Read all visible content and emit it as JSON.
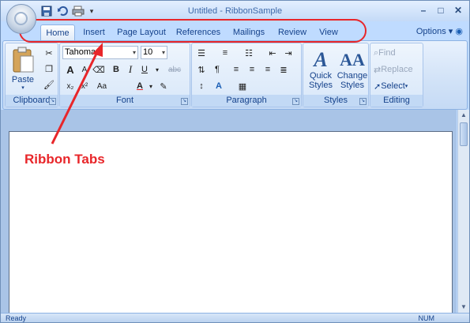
{
  "window": {
    "title": "Untitled - RibbonSample"
  },
  "quick_access": {
    "items": [
      "save-icon",
      "undo-icon",
      "print-icon"
    ]
  },
  "tabs": [
    {
      "label": "Home",
      "active": true
    },
    {
      "label": "Insert"
    },
    {
      "label": "Page Layout"
    },
    {
      "label": "References"
    },
    {
      "label": "Mailings"
    },
    {
      "label": "Review"
    },
    {
      "label": "View"
    }
  ],
  "options_label": "Options",
  "clipboard": {
    "label": "Clipboard",
    "paste_label": "Paste"
  },
  "font": {
    "label": "Font",
    "family": "Tahoma",
    "size": "10",
    "bold": "B",
    "italic": "I",
    "underline": "U",
    "font_color_glyph": "A",
    "grow_glyph": "A",
    "shrink_glyph": "A",
    "clear_glyph": "abc"
  },
  "paragraph": {
    "label": "Paragraph"
  },
  "styles": {
    "label": "Styles",
    "quick_styles_line1": "Quick",
    "quick_styles_line2": "Styles",
    "change_styles_line1": "Change",
    "change_styles_line2": "Styles"
  },
  "editing": {
    "label": "Editing",
    "find_label": "Find",
    "replace_label": "Replace",
    "select_label": "Select"
  },
  "status": {
    "ready": "Ready",
    "num": "NUM"
  },
  "annotation": {
    "text": "Ribbon Tabs",
    "color": "#e8262a"
  }
}
